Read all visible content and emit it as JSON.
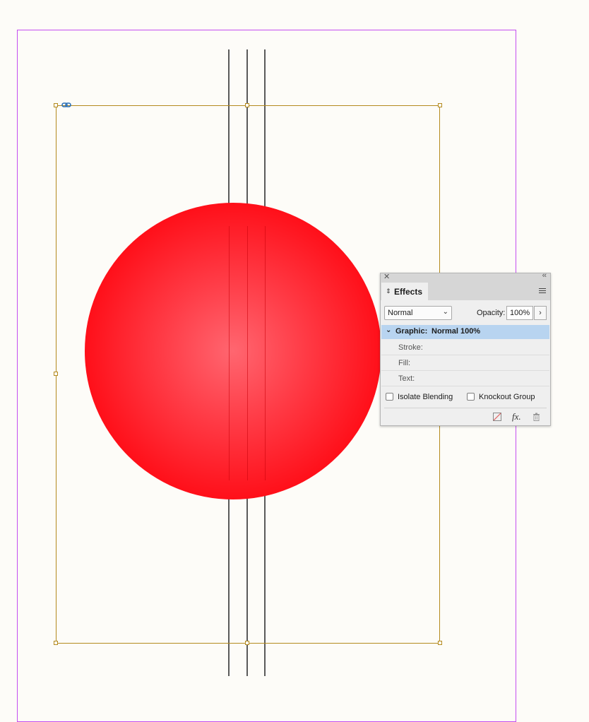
{
  "panel": {
    "tab_label": "Effects",
    "blend_mode": "Normal",
    "opacity_label": "Opacity:",
    "opacity_value": "100%",
    "graphic_label": "Graphic:",
    "graphic_value": "Normal 100%",
    "stroke_label": "Stroke:",
    "fill_label": "Fill:",
    "text_label": "Text:",
    "isolate_label": "Isolate Blending",
    "knockout_label": "Knockout Group",
    "fx_label": "fx."
  },
  "colors": {
    "page_boundary": "#c44df0",
    "frame": "#b48a1e",
    "sphere": "#ff0a14",
    "selection_row": "#b8d4f0"
  },
  "icons": [
    "close-icon",
    "collapse-icon",
    "panel-menu-icon",
    "clear-effects-icon",
    "fx-icon",
    "trash-icon",
    "link-icon"
  ]
}
